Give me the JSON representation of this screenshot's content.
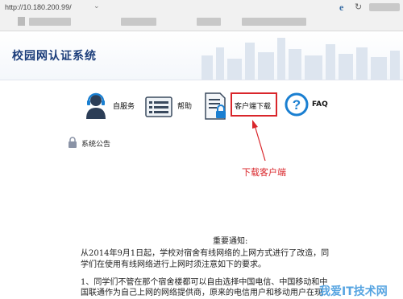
{
  "browser": {
    "address": "http://10.180.200.99/",
    "caret": "⌄",
    "ie_glyph": "e",
    "refresh_glyph": "↻"
  },
  "header": {
    "title": "校园网认证系统"
  },
  "nav": {
    "self_service": "自服务",
    "help": "帮助",
    "client_download": "客户端下载",
    "faq": "FAQ"
  },
  "notice_link": "系统公告",
  "annotation": "下载客户端",
  "notice": {
    "title": "重要通知:",
    "p1_line1": "从2014年9月1日起，学校对宿舍有线网络的上网方式进行了改造，同",
    "p1_line2": "学们在使用有线网络进行上网时须注意如下的要求。",
    "p2_line1": "1、同学们不管在那个宿舍楼都可以自由选择中国电信、中国移动和中",
    "p2_line2": "国联通作为自己上网的网络提供商，原来的电信用户和移动用户在现"
  },
  "watermark": "我爱IT技术网",
  "colors": {
    "accent_red": "#d9262b",
    "title_blue": "#1b3d7a",
    "faq_blue": "#1a7fd1"
  }
}
